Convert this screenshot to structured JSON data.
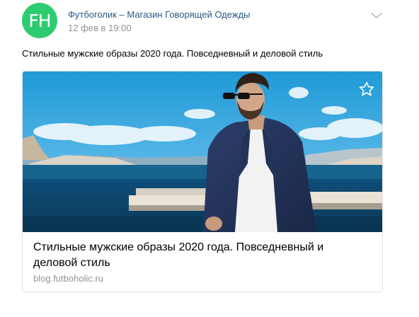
{
  "post": {
    "avatar_initials": "FH",
    "author": "Футбоголик – Магазин Говорящей Одежды",
    "date": "12 фев в 19:00",
    "text": "Стильные мужские образы 2020 года. Повседневный и деловой стиль",
    "menu_icon": "chevron-down-icon"
  },
  "attachment": {
    "title": "Стильные мужские образы 2020 года. Повседневный и деловой стиль",
    "domain": "blog.futboholic.ru",
    "fave_icon": "star-outline-icon",
    "photo": "man-in-blue-blazer-by-sea-photo"
  },
  "colors": {
    "avatar_bg": "#2ecc71",
    "link": "#2a5885",
    "meta": "#939393",
    "border": "#e3e4e8"
  }
}
